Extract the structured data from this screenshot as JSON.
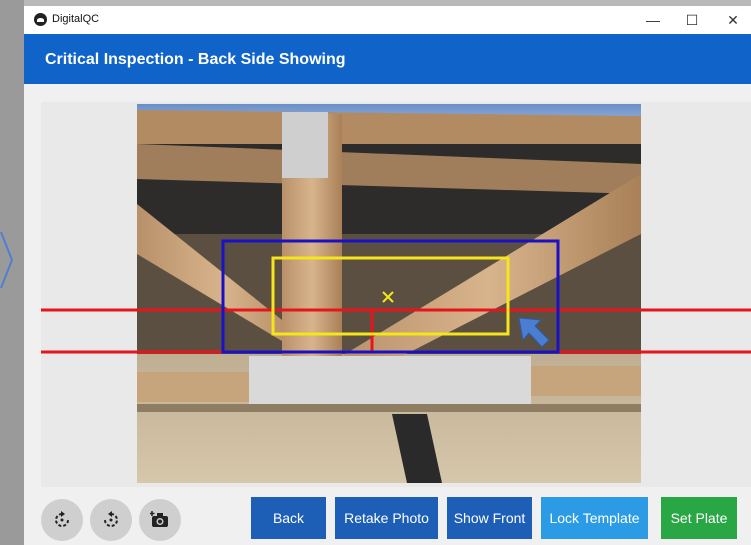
{
  "window": {
    "app_name": "DigitalQC",
    "minimize": "—",
    "maximize": "☐",
    "close": "✕"
  },
  "header": {
    "title": "Critical Inspection - Back Side Showing"
  },
  "toolbar": {
    "rotate_left_icon": "rotate-ccw-icon",
    "rotate_right_icon": "rotate-cw-icon",
    "camera_icon": "camera-icon",
    "back_label": "Back",
    "retake_label": "Retake Photo",
    "show_front_label": "Show Front",
    "lock_template_label": "Lock Template",
    "set_plate_label": "Set Plate"
  },
  "colors": {
    "header": "#0f63c9",
    "back": "#1d5fb7",
    "retake": "#1d5fb7",
    "show_front": "#1d5fb7",
    "lock_template": "#2b9be6",
    "set_plate": "#28a744",
    "guide_line": "#e8141c",
    "outer_box": "#1a10c8",
    "inner_box": "#f5e61a",
    "pointer": "#4a7ed0"
  }
}
